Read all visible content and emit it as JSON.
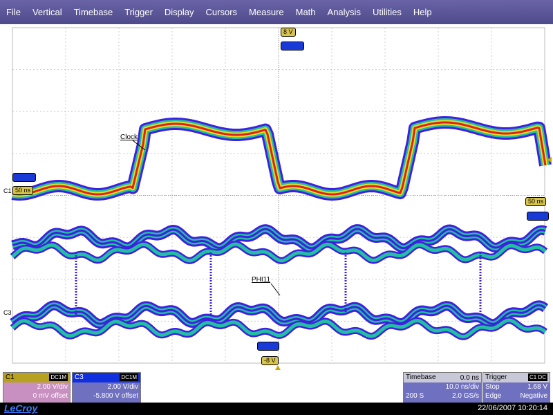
{
  "menu": [
    "File",
    "Vertical",
    "Timebase",
    "Trigger",
    "Display",
    "Cursors",
    "Measure",
    "Math",
    "Analysis",
    "Utilities",
    "Help"
  ],
  "markers": {
    "top_level": "8 V",
    "bottom_level": "-8 V",
    "left_time": "50 ns",
    "right_time": "50 ns",
    "c1_marker": "C1",
    "c3_marker": "C3"
  },
  "traces": {
    "clock_label": "Clock",
    "phi_label": "PHI11"
  },
  "channels": {
    "c1": {
      "name": "C1",
      "coupling": "DC1M",
      "vdiv": "2.00 V/div",
      "offset": "0 mV offset",
      "header_color": "#b8a020",
      "body_color": "#c890c0"
    },
    "c3": {
      "name": "C3",
      "coupling": "DC1M",
      "vdiv": "2.00 V/div",
      "offset": "-5.800 V offset",
      "header_color": "#1030e0",
      "body_color": "#7070c0"
    }
  },
  "timebase": {
    "title": "Timebase",
    "delay": "0.0 ns",
    "tdiv": "10.0 ns/div",
    "samples": "200 S",
    "rate": "2.0 GS/s"
  },
  "trigger": {
    "title": "Trigger",
    "badge": "C1 DC",
    "mode": "Stop",
    "level": "1.68 V",
    "type": "Edge",
    "slope": "Negative"
  },
  "footer": {
    "brand": "LeCroy",
    "datetime": "22/06/2007 10:20:14"
  },
  "colors": {
    "menubar": "#5a56a0",
    "grid_bg": "#ffffff",
    "persistence_hot": "#e02020",
    "persistence_warm": "#e0e020",
    "persistence_mid": "#20c0a0",
    "persistence_cold": "#4020e0"
  }
}
